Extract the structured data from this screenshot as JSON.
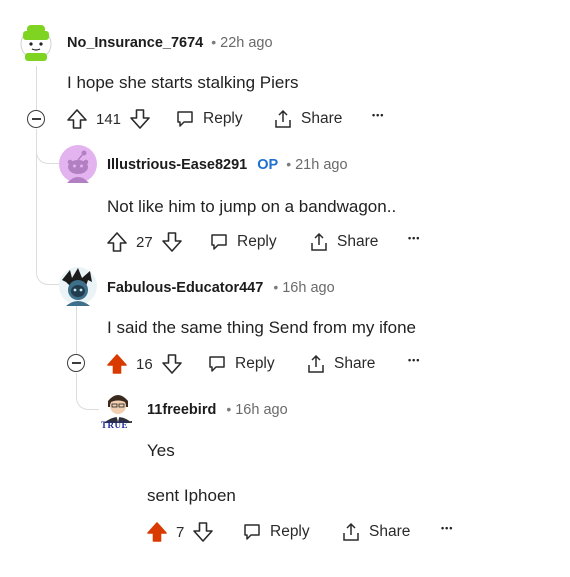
{
  "comments": [
    {
      "username": "No_Insurance_7674",
      "separator": "•",
      "time": "22h ago",
      "body": [
        "I hope she starts stalking Piers"
      ],
      "votes": "141",
      "upvoted": false,
      "reply_label": "Reply",
      "share_label": "Share",
      "more_label": "•••"
    },
    {
      "username": "Illustrious-Ease8291",
      "badge": "OP",
      "separator": "•",
      "time": "21h ago",
      "body": [
        "Not like him to jump on a bandwagon.."
      ],
      "votes": "27",
      "upvoted": false,
      "reply_label": "Reply",
      "share_label": "Share",
      "more_label": "•••"
    },
    {
      "username": "Fabulous-Educator447",
      "separator": "•",
      "time": "16h ago",
      "body": [
        "I said the same thing Send from my ifone"
      ],
      "votes": "16",
      "upvoted": true,
      "reply_label": "Reply",
      "share_label": "Share",
      "more_label": "•••"
    },
    {
      "username": "11freebird",
      "separator": "•",
      "time": "16h ago",
      "body": [
        "Yes",
        "sent Iphoen"
      ],
      "votes": "7",
      "upvoted": true,
      "reply_label": "Reply",
      "share_label": "Share",
      "more_label": "•••",
      "avatar_text": "TRUE"
    }
  ],
  "colors": {
    "upvote_active": "#d93a00",
    "op_badge": "#1f6fd1",
    "thread_line": "#dcdcdc"
  },
  "icons": [
    "upvote-icon",
    "downvote-icon",
    "reply-icon",
    "share-icon",
    "more-icon",
    "collapse-icon"
  ]
}
